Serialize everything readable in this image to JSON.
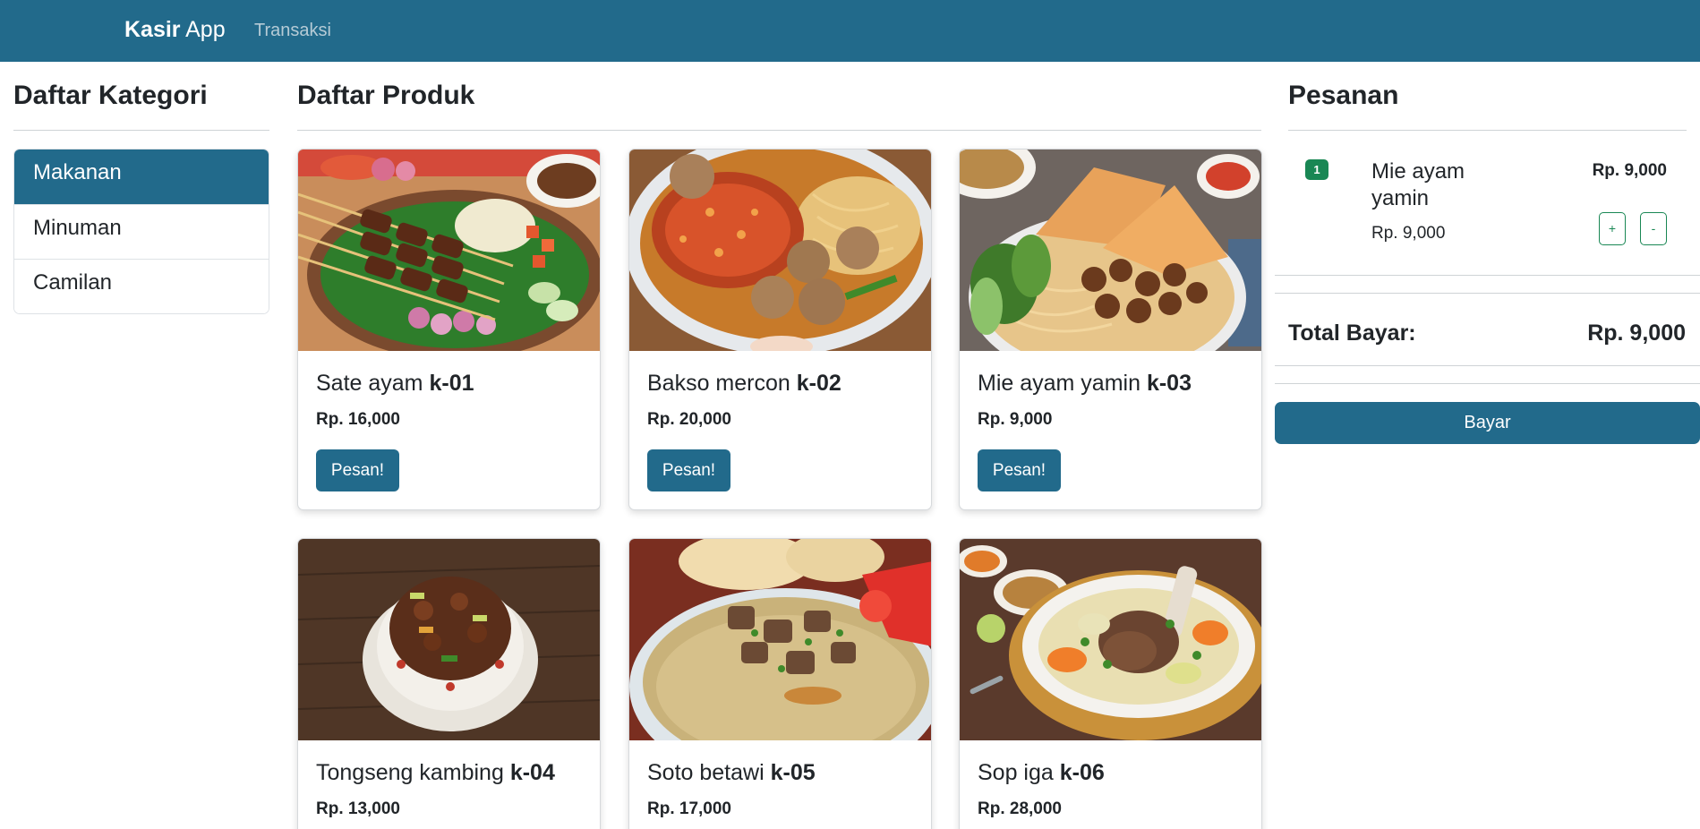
{
  "navbar": {
    "brand_bold": "Kasir",
    "brand_rest": " App",
    "link_transaksi": "Transaksi"
  },
  "categories": {
    "title": "Daftar Kategori",
    "items": [
      {
        "label": "Makanan",
        "active": true
      },
      {
        "label": "Minuman",
        "active": false
      },
      {
        "label": "Camilan",
        "active": false
      }
    ]
  },
  "products": {
    "title": "Daftar Produk",
    "button_label": "Pesan!",
    "items": [
      {
        "name": "Sate ayam",
        "code": "k-01",
        "price": "Rp. 16,000",
        "image": "sate-ayam"
      },
      {
        "name": "Bakso mercon",
        "code": "k-02",
        "price": "Rp. 20,000",
        "image": "bakso-mercon"
      },
      {
        "name": "Mie ayam yamin",
        "code": "k-03",
        "price": "Rp. 9,000",
        "image": "mie-ayam-yamin"
      },
      {
        "name": "Tongseng kambing",
        "code": "k-04",
        "price": "Rp. 13,000",
        "image": "tongseng-kambing"
      },
      {
        "name": "Soto betawi",
        "code": "k-05",
        "price": "Rp. 17,000",
        "image": "soto-betawi"
      },
      {
        "name": "Sop iga",
        "code": "k-06",
        "price": "Rp. 28,000",
        "image": "sop-iga"
      }
    ]
  },
  "order": {
    "title": "Pesanan",
    "items": [
      {
        "qty": "1",
        "name": "Mie ayam yamin",
        "unit_price": "Rp. 9,000",
        "subtotal": "Rp. 9,000",
        "plus_label": "+",
        "minus_label": "-"
      }
    ],
    "total_label": "Total Bayar:",
    "total_value": "Rp. 9,000",
    "pay_button": "Bayar"
  },
  "colors": {
    "primary": "#226a8b",
    "success": "#198754",
    "text": "#212529"
  }
}
